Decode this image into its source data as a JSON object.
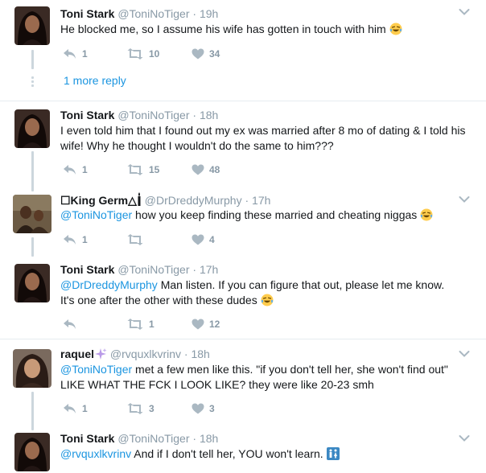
{
  "tweets": [
    {
      "name": "Toni Stark",
      "handle": "@ToniNoTiger",
      "sep": "·",
      "time": "19h",
      "text": "He blocked me, so I assume his wife has gotten in touch with him",
      "reply": "1",
      "retweet": "10",
      "like": "34"
    },
    {
      "name": "Toni Stark",
      "handle": "@ToniNoTiger",
      "sep": "·",
      "time": "18h",
      "text": "I even told him that I found out my ex was married after 8 mo of dating & I told his wife! Why he thought I wouldn't do the same to him???",
      "reply": "1",
      "retweet": "15",
      "like": "48"
    },
    {
      "name": "☐King Germ△",
      "handle": "@DrDreddyMurphy",
      "sep": "·",
      "time": "17h",
      "mention": "@ToniNoTiger",
      "text": " how you keep finding these married and cheating niggas",
      "reply": "1",
      "retweet": "",
      "like": "4"
    },
    {
      "name": "Toni Stark",
      "handle": "@ToniNoTiger",
      "sep": "·",
      "time": "17h",
      "mention": "@DrDreddyMurphy",
      "text_line1": " Man listen. If you can figure that out, please let me know.",
      "text_line2": "It's one after the other with these dudes",
      "reply": "",
      "retweet": "1",
      "like": "12"
    },
    {
      "name": "raquel",
      "handle": "@rvquxlkvrinv",
      "sep": "·",
      "time": "18h",
      "mention": "@ToniNoTiger",
      "text_line1": " met a few men like this. \"if you don't tell her, she won't find out\"",
      "text_line2": "LIKE WHAT THE FCK I LOOK LIKE? they were like 20-23 smh",
      "reply": "1",
      "retweet": "3",
      "like": "3"
    },
    {
      "name": "Toni Stark",
      "handle": "@ToniNoTiger",
      "sep": "·",
      "time": "18h",
      "mention": "@rvquxlkvrinv",
      "text": " And if I don't tell her, YOU won't learn."
    }
  ],
  "more_reply": "1 more reply",
  "colors": {
    "link": "#1b95e0",
    "muted": "#8899a6",
    "text": "#14171a",
    "thread": "#ccd6dd",
    "divider": "#e6ecf0"
  },
  "icons": [
    "reply-icon",
    "retweet-icon",
    "like-icon",
    "chevron-down-icon",
    "laughing-emoji",
    "sparkles-emoji",
    "candle-emoji",
    "restroom-emoji"
  ]
}
